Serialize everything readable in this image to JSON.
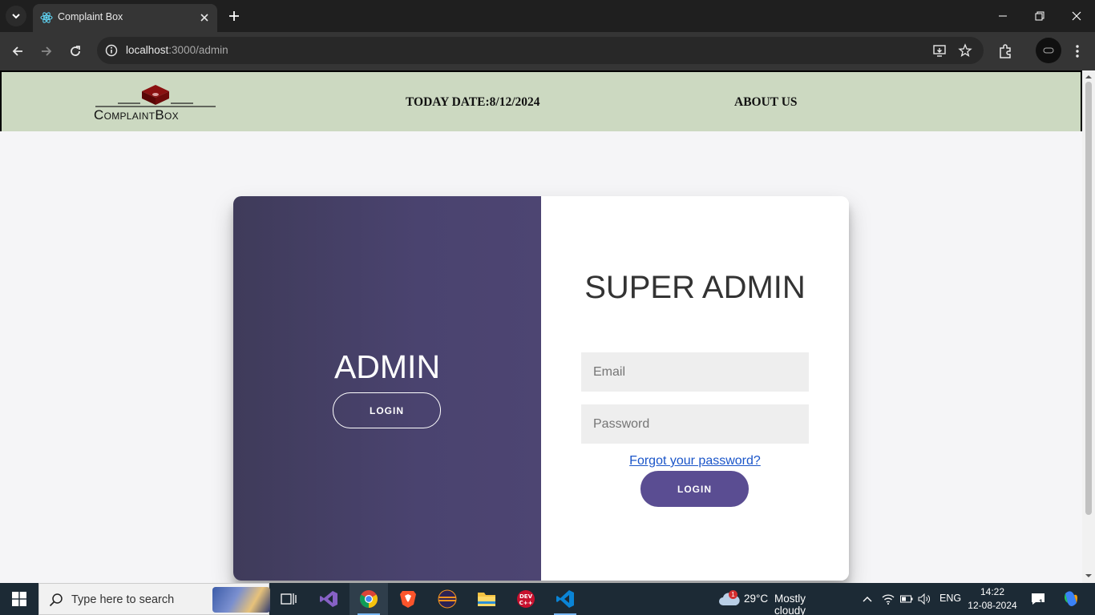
{
  "browser": {
    "tab_title": "Complaint Box",
    "url_host": "localhost",
    "url_path": ":3000/admin"
  },
  "header": {
    "logo_text": "ComplaintBox",
    "date_label": "TODAY DATE:8/12/2024",
    "about_label": "ABOUT US"
  },
  "left_panel": {
    "title": "ADMIN",
    "button_label": "LOGIN"
  },
  "right_panel": {
    "title": "SUPER ADMIN",
    "email_placeholder": "Email",
    "password_placeholder": "Password",
    "forgot_link": "Forgot your password?",
    "button_label": "LOGIN"
  },
  "taskbar": {
    "search_placeholder": "Type here to search",
    "weather_temp": "29°C",
    "weather_desc": "Mostly cloudy",
    "weather_badge": "1",
    "language": "ENG",
    "time": "14:22",
    "date": "12-08-2024",
    "notification_count": "1"
  },
  "colors": {
    "header_bg": "#ccd9c1",
    "left_panel_bg": "#4a436f",
    "login_button_bg": "#5a4d92",
    "link": "#1a55c9"
  }
}
